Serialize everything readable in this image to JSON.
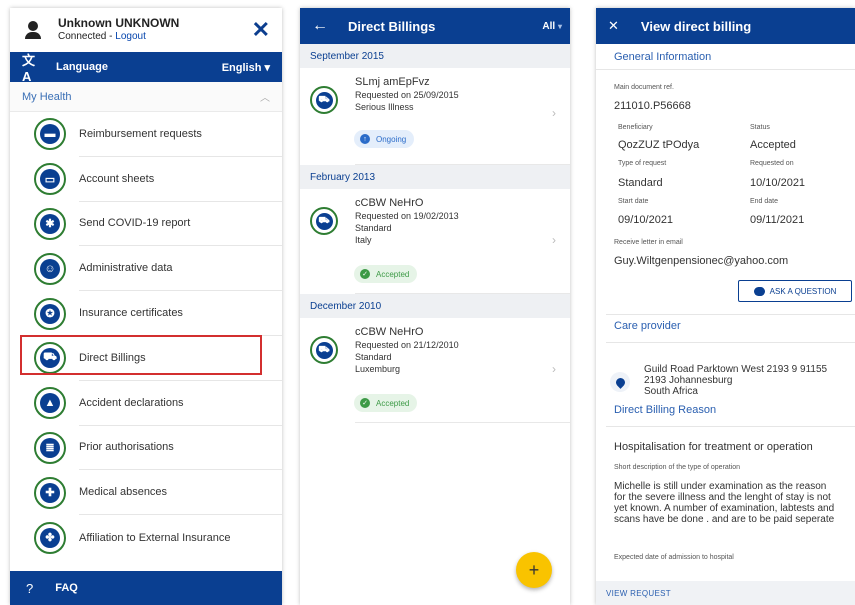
{
  "menu_panel": {
    "user_name": "Unknown UNKNOWN",
    "connected_text": "Connected - ",
    "logout_label": "Logout",
    "close_icon": "close-icon",
    "language_label": "Language",
    "language_value": "English",
    "section_label": "My Health",
    "items": [
      {
        "label": "Reimbursement requests",
        "icon": "wallet-icon"
      },
      {
        "label": "Account sheets",
        "icon": "card-icon"
      },
      {
        "label": "Send COVID-19 report",
        "icon": "virus-icon"
      },
      {
        "label": "Administrative data",
        "icon": "id-icon"
      },
      {
        "label": "Insurance certificates",
        "icon": "certificate-icon"
      },
      {
        "label": "Direct Billings",
        "icon": "ambulance-icon"
      },
      {
        "label": "Accident declarations",
        "icon": "warning-icon"
      },
      {
        "label": "Prior authorisations",
        "icon": "document-icon"
      },
      {
        "label": "Medical absences",
        "icon": "medkit-icon"
      },
      {
        "label": "Affiliation to External Insurance",
        "icon": "puzzle-icon"
      }
    ],
    "faq_label": "FAQ"
  },
  "list_panel": {
    "title": "Direct Billings",
    "filter_label": "All",
    "groups": [
      {
        "header": "September 2015",
        "name": "SLmj amEpFvz",
        "lines": [
          "Requested on 25/09/2015",
          "Serious Illness"
        ],
        "status": "Ongoing"
      },
      {
        "header": "February 2013",
        "name": "cCBW NeHrO",
        "lines": [
          "Requested on 19/02/2013",
          "Standard",
          "Italy"
        ],
        "status": "Accepted"
      },
      {
        "header": "December 2010",
        "name": "cCBW NeHrO",
        "lines": [
          "Requested on 21/12/2010",
          "Standard",
          "Luxemburg"
        ],
        "status": "Accepted"
      }
    ],
    "fab_label": "+"
  },
  "detail_panel": {
    "title": "View direct billing",
    "general_info": "General Information",
    "main_doc_label": "Main document ref.",
    "main_doc_value": "211010.P56668",
    "beneficiary_label": "Beneficiary",
    "beneficiary_value": "QozZUZ tPOdya",
    "status_label": "Status",
    "status_value": "Accepted",
    "type_label": "Type of request",
    "type_value": "Standard",
    "requested_label": "Requested on",
    "requested_value": "10/10/2021",
    "start_label": "Start date",
    "start_value": "09/10/2021",
    "end_label": "End date",
    "end_value": "09/11/2021",
    "email_label": "Receive letter in email",
    "email_value": "Guy.Wiltgenpensionec@yahoo.com",
    "ask_label": "ASK A QUESTION",
    "care_provider": "Care provider",
    "address_lines": [
      "Guild Road Parktown West 2193 9 91155",
      "2193 Johannesburg",
      "South Africa"
    ],
    "reason_section": "Direct Billing Reason",
    "reason_value": "Hospitalisation for treatment or operation",
    "short_desc_label": "Short description of the type of operation",
    "short_desc_value": "Michelle is still under examination as the reason for the severe illness and the lenght of stay is not yet known. A number of examination, labtests and scans have be done . and are to be paid seperate",
    "admission_label": "Expected date of admission to hospital",
    "view_request": "VIEW REQUEST"
  }
}
